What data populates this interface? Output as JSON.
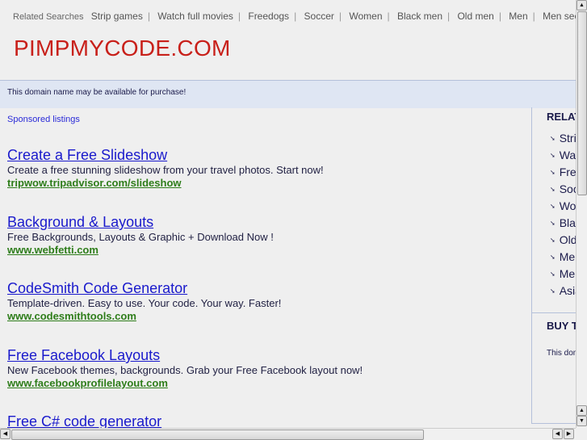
{
  "related_bar": {
    "label": "Related Searches",
    "items": [
      "Strip games",
      "Watch full movies",
      "Freedogs",
      "Soccer",
      "Women",
      "Black men",
      "Old men",
      "Men",
      "Men seeking women"
    ]
  },
  "site_title": "PIMPMYCODE.COM",
  "banner_text": "This domain name may be available for purchase!",
  "sponsored_label": "Sponsored listings",
  "listings": [
    {
      "title": "Create a Free Slideshow",
      "desc": "Create a free stunning slideshow from your travel photos. Start now!",
      "url": "tripwow.tripadvisor.com/slideshow"
    },
    {
      "title": "Background & Layouts",
      "desc": "Free Backgrounds, Layouts & Graphic + Download Now !",
      "url": "www.webfetti.com"
    },
    {
      "title": "CodeSmith Code Generator",
      "desc": "Template-driven. Easy to use. Your code. Your way. Faster!",
      "url": "www.codesmithtools.com"
    },
    {
      "title": "Free Facebook Layouts",
      "desc": "New Facebook themes, backgrounds. Grab your Free Facebook layout now!",
      "url": "www.facebookprofilelayout.com"
    },
    {
      "title": "Free C# code generator",
      "desc": "",
      "url": ""
    }
  ],
  "sidebar": {
    "heading": "RELATED SEARCHES",
    "items": [
      "Strip games",
      "Watch full movies",
      "Freedogs",
      "Soccer",
      "Women",
      "Black men",
      "Old men",
      "Men",
      "Men seeking women",
      "Asian"
    ],
    "buy_heading": "BUY THIS DOMAIN",
    "buy_text": "This domain name may be available for purchase!"
  },
  "colors": {
    "title": "#c8201a",
    "link": "#1a1acc",
    "url": "#2e7d1a",
    "banner": "#dfe6f3"
  }
}
